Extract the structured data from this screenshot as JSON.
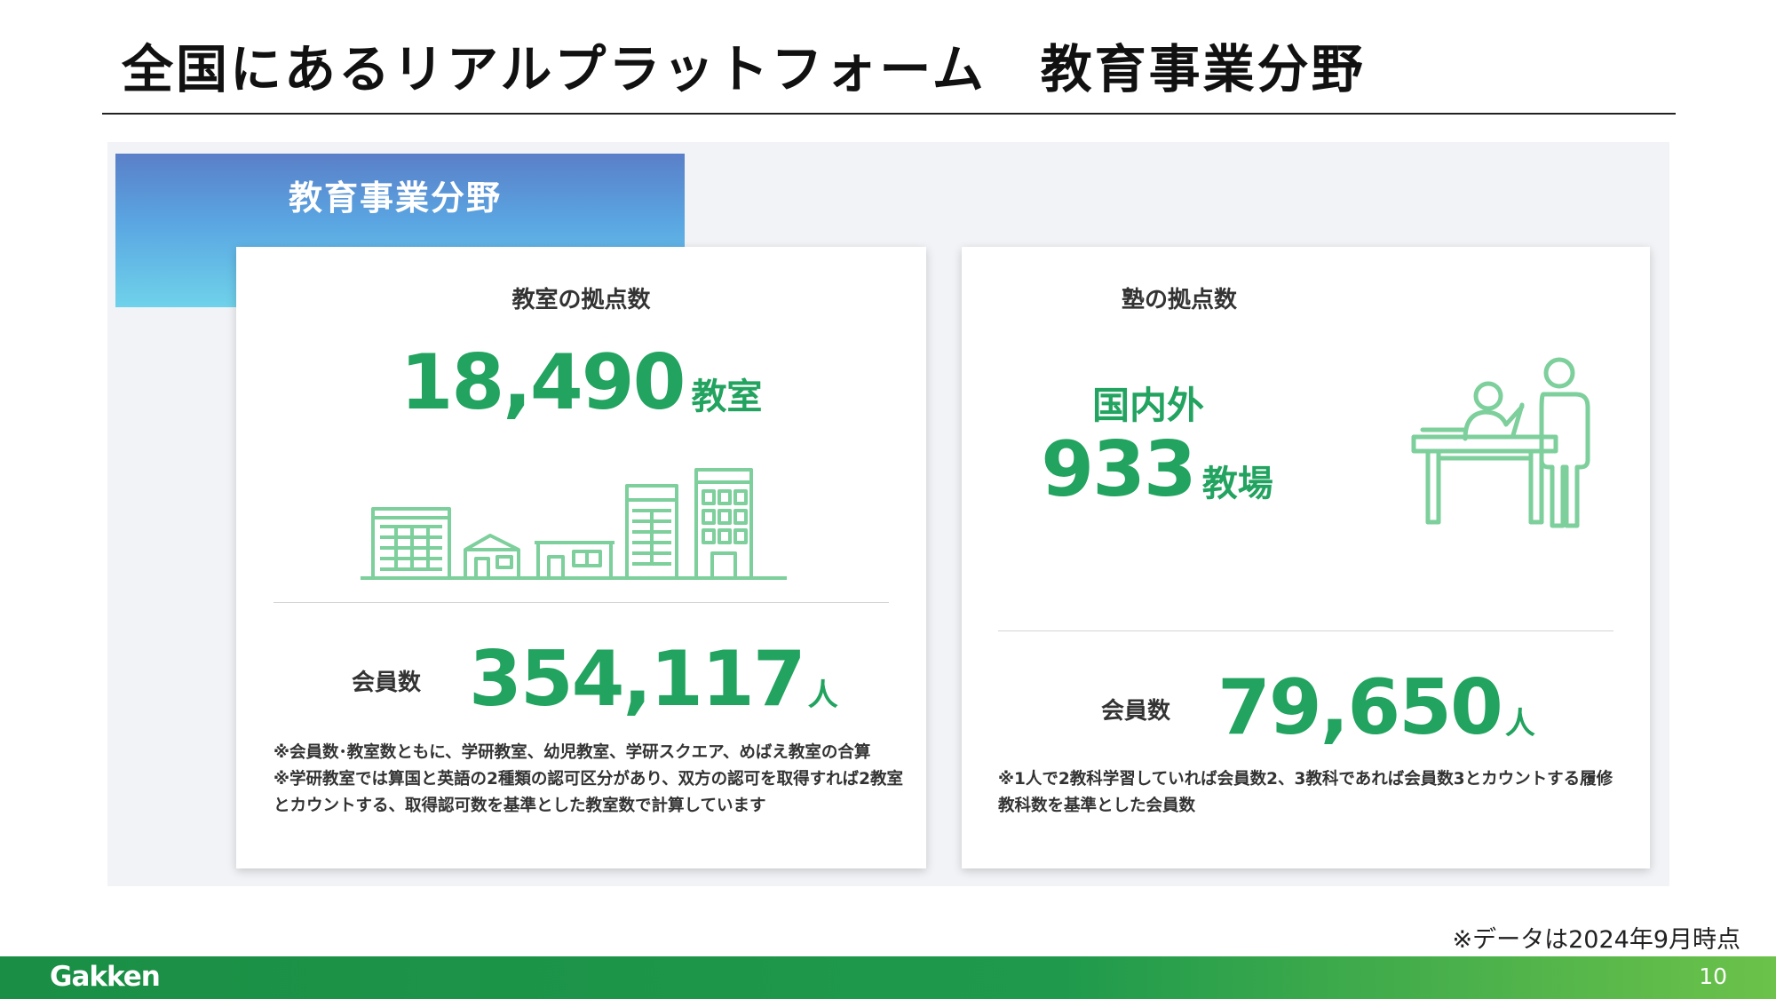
{
  "header": {
    "title": "全国にあるリアルプラットフォーム　教育事業分野"
  },
  "section": {
    "label": "教育事業分野"
  },
  "classrooms": {
    "label": "教室の拠点数",
    "count": "18,490",
    "count_unit": "教室",
    "members_label": "会員数",
    "members": "354,117",
    "members_unit": "人",
    "note1": "※会員数･教室数ともに、学研教室、幼児教室、学研スクエア、めばえ教室の合算",
    "note2": "※学研教室では算国と英語の2種類の認可区分があり、双方の認可を取得すれば2教室とカウントする、取得認可数を基準とした教室数で計算しています"
  },
  "juku": {
    "label": "塾の拠点数",
    "scope": "国内外",
    "count": "933",
    "count_unit": "教場",
    "members_label": "会員数",
    "members": "79,650",
    "members_unit": "人",
    "note": "※1人で2教科学習していれば会員数2、3教科であれば会員数3とカウントする履修教科数を基準とした会員数"
  },
  "footer": {
    "as_of": "※データは2024年9月時点",
    "logo": "Gakken",
    "page_number": "10"
  },
  "colors": {
    "accent_green": "#22a35f",
    "icon_green": "#7dcf9b",
    "tab_blue_top": "#5a7fc8",
    "tab_blue_bottom": "#6fd2ea",
    "footer_green": "#1a8e45"
  },
  "icons": {
    "buildings": "buildings-illustration-icon",
    "teaching": "teacher-student-desk-icon"
  }
}
